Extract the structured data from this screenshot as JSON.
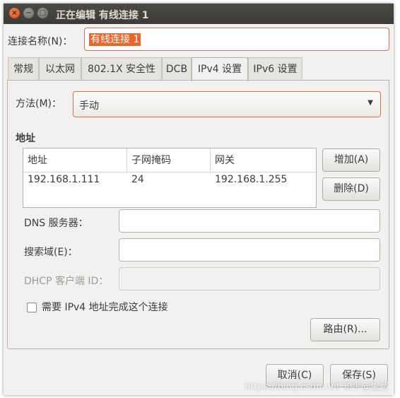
{
  "window": {
    "title": "正在编辑 有线连接 1",
    "close_glyph": "×",
    "min_glyph": "−",
    "max_glyph": "□"
  },
  "connection_name": {
    "label": "连接名称(N)：",
    "value": "有线连接 1"
  },
  "tabs": [
    {
      "label": "常规"
    },
    {
      "label": "以太网"
    },
    {
      "label": "802.1X 安全性"
    },
    {
      "label": "DCB"
    },
    {
      "label": "IPv4 设置",
      "active": true
    },
    {
      "label": "IPv6 设置"
    }
  ],
  "method": {
    "label": "方法(M)：",
    "value": "手动",
    "arrow": "▼"
  },
  "address_section": {
    "heading": "地址",
    "columns": [
      "地址",
      "子网掩码",
      "网关"
    ],
    "rows": [
      [
        "192.168.1.111",
        "24",
        "192.168.1.255"
      ]
    ],
    "add_button": "增加(A)",
    "delete_button": "删除(D)"
  },
  "dns": {
    "label": "DNS 服务器：",
    "value": ""
  },
  "search_domains": {
    "label": "搜索域(E)：",
    "value": ""
  },
  "dhcp_client_id": {
    "label": "DHCP 客户端 ID：",
    "value": ""
  },
  "require_ipv4": {
    "label": "需要 IPv4 地址完成这个连接",
    "checked": false
  },
  "routes_button": "路由(R)...",
  "footer": {
    "cancel": "取消(C)",
    "save": "保存(S)"
  },
  "watermark": "https://blog.csdn.net 知乎@生超"
}
